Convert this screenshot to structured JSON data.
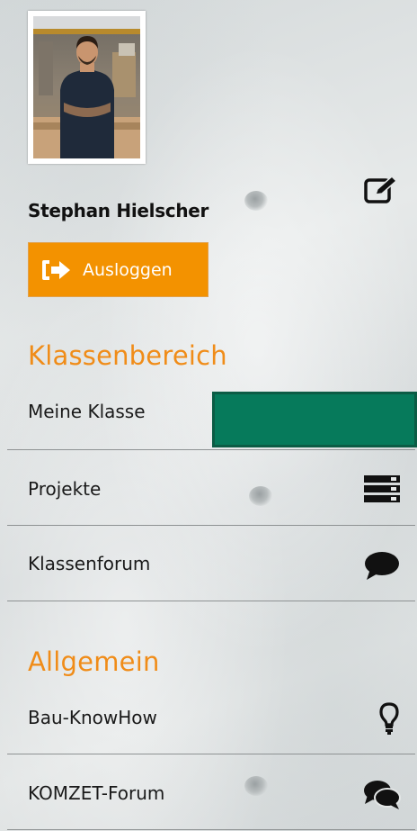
{
  "profile": {
    "name": "Stephan Hielscher",
    "edit_icon": "edit-icon",
    "avatar_alt": "profile-photo"
  },
  "logout": {
    "label": "Ausloggen",
    "icon": "sign-out-icon",
    "color": "#f39200"
  },
  "sections": {
    "klassenbereich": {
      "heading": "Klassenbereich",
      "items": [
        {
          "label": "Meine Klasse",
          "icon": "",
          "active": true
        },
        {
          "label": "Projekte",
          "icon": "server-stack-icon"
        },
        {
          "label": "Klassenforum",
          "icon": "comment-icon"
        }
      ]
    },
    "allgemein": {
      "heading": "Allgemein",
      "items": [
        {
          "label": "Bau-KnowHow",
          "icon": "lightbulb-icon"
        },
        {
          "label": "KOMZET-Forum",
          "icon": "comments-icon"
        }
      ]
    }
  },
  "colors": {
    "accent": "#f08c18",
    "active": "#067a5b",
    "divider": "#8e9293"
  }
}
